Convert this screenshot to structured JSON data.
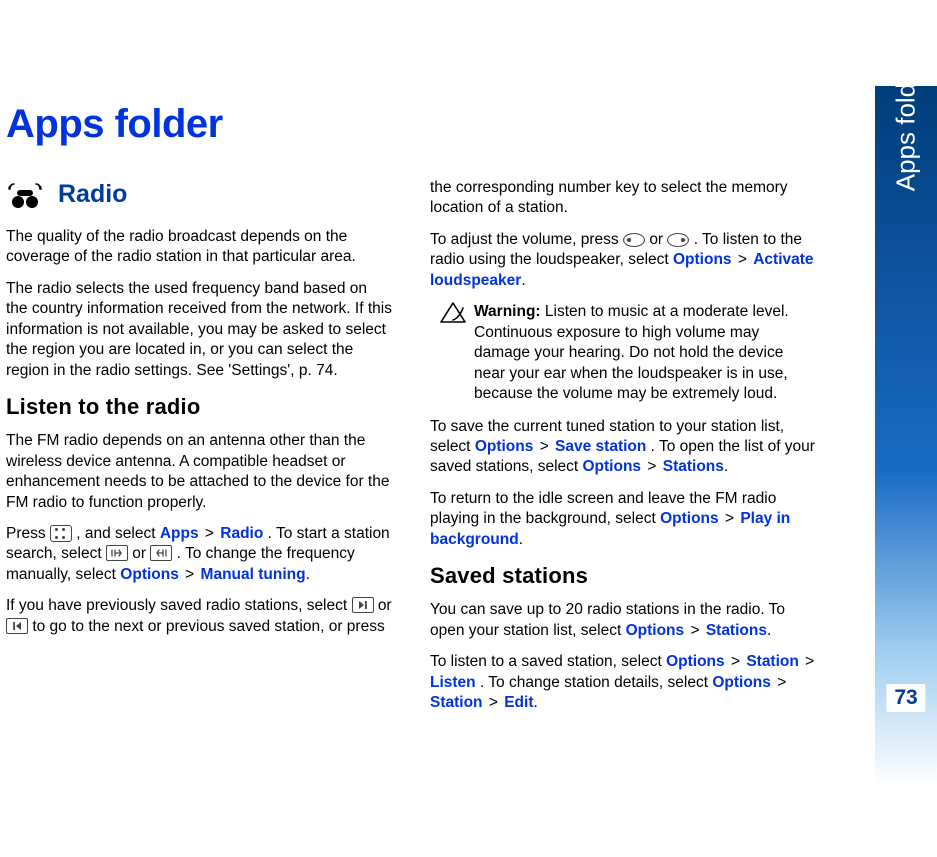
{
  "sidebar": {
    "label": "Apps folder"
  },
  "page_number": "73",
  "title": "Apps folder",
  "left": {
    "radio_heading": "Radio",
    "p1": "The quality of the radio broadcast depends on the coverage of the radio station in that particular area.",
    "p2": "The radio selects the used frequency band based on the country information received from the network. If this information is not available, you may be asked to select the region you are located in, or you can select the region in the radio settings. See 'Settings', p. 74.",
    "sub1": "Listen to the radio",
    "p3": "The FM radio depends on an antenna other than the wireless device antenna. A compatible headset or enhancement needs to be attached to the device for the FM radio to function properly.",
    "p4_a": "Press ",
    "p4_b": " , and select ",
    "p4_apps": "Apps",
    "p4_sep": " > ",
    "p4_radio": "Radio",
    "p4_c": ". To start a station search, select ",
    "p4_or": " or ",
    "p4_d": " . To change the frequency manually, select ",
    "p4_options": "Options",
    "p4_manual": "Manual tuning",
    "p4_end": ".",
    "p5_a": "If you have previously saved radio stations, select ",
    "p5_or": " or ",
    "p5_b": " to go to the next or previous saved station, or press"
  },
  "right": {
    "p1": "the corresponding number key to select the memory location of a station.",
    "p2_a": "To adjust the volume, press ",
    "p2_or": " or ",
    "p2_b": ". To listen to the radio using the loudspeaker, select ",
    "p2_options": "Options",
    "p2_sep": " > ",
    "p2_activate": "Activate loudspeaker",
    "p2_end": ".",
    "warn_label": "Warning:",
    "warn_text": " Listen to music at a moderate level. Continuous exposure to high volume may damage your hearing. Do not hold the device near your ear when the loudspeaker is in use, because the volume may be extremely loud.",
    "p3_a": "To save the current tuned station to your station list, select ",
    "p3_options": "Options",
    "p3_sep": " > ",
    "p3_save": "Save station",
    "p3_b": ". To open the list of your saved stations, select ",
    "p3_options2": "Options",
    "p3_stations": "Stations",
    "p3_end": ".",
    "p4_a": "To return to the idle screen and leave the FM radio playing in the background, select ",
    "p4_options": "Options",
    "p4_sep": " > ",
    "p4_play": "Play in background",
    "p4_end": ".",
    "sub2": "Saved stations",
    "p5_a": "You can save up to 20 radio stations in the radio. To open your station list, select ",
    "p5_options": "Options",
    "p5_sep": " > ",
    "p5_stations": "Stations",
    "p5_end": ".",
    "p6_a": "To listen to a saved station, select ",
    "p6_options": "Options",
    "p6_sep": " > ",
    "p6_station": "Station",
    "p6_listen": "Listen",
    "p6_b": ". To change station details, select ",
    "p6_options2": "Options",
    "p6_station2": "Station",
    "p6_edit": "Edit",
    "p6_end": "."
  }
}
